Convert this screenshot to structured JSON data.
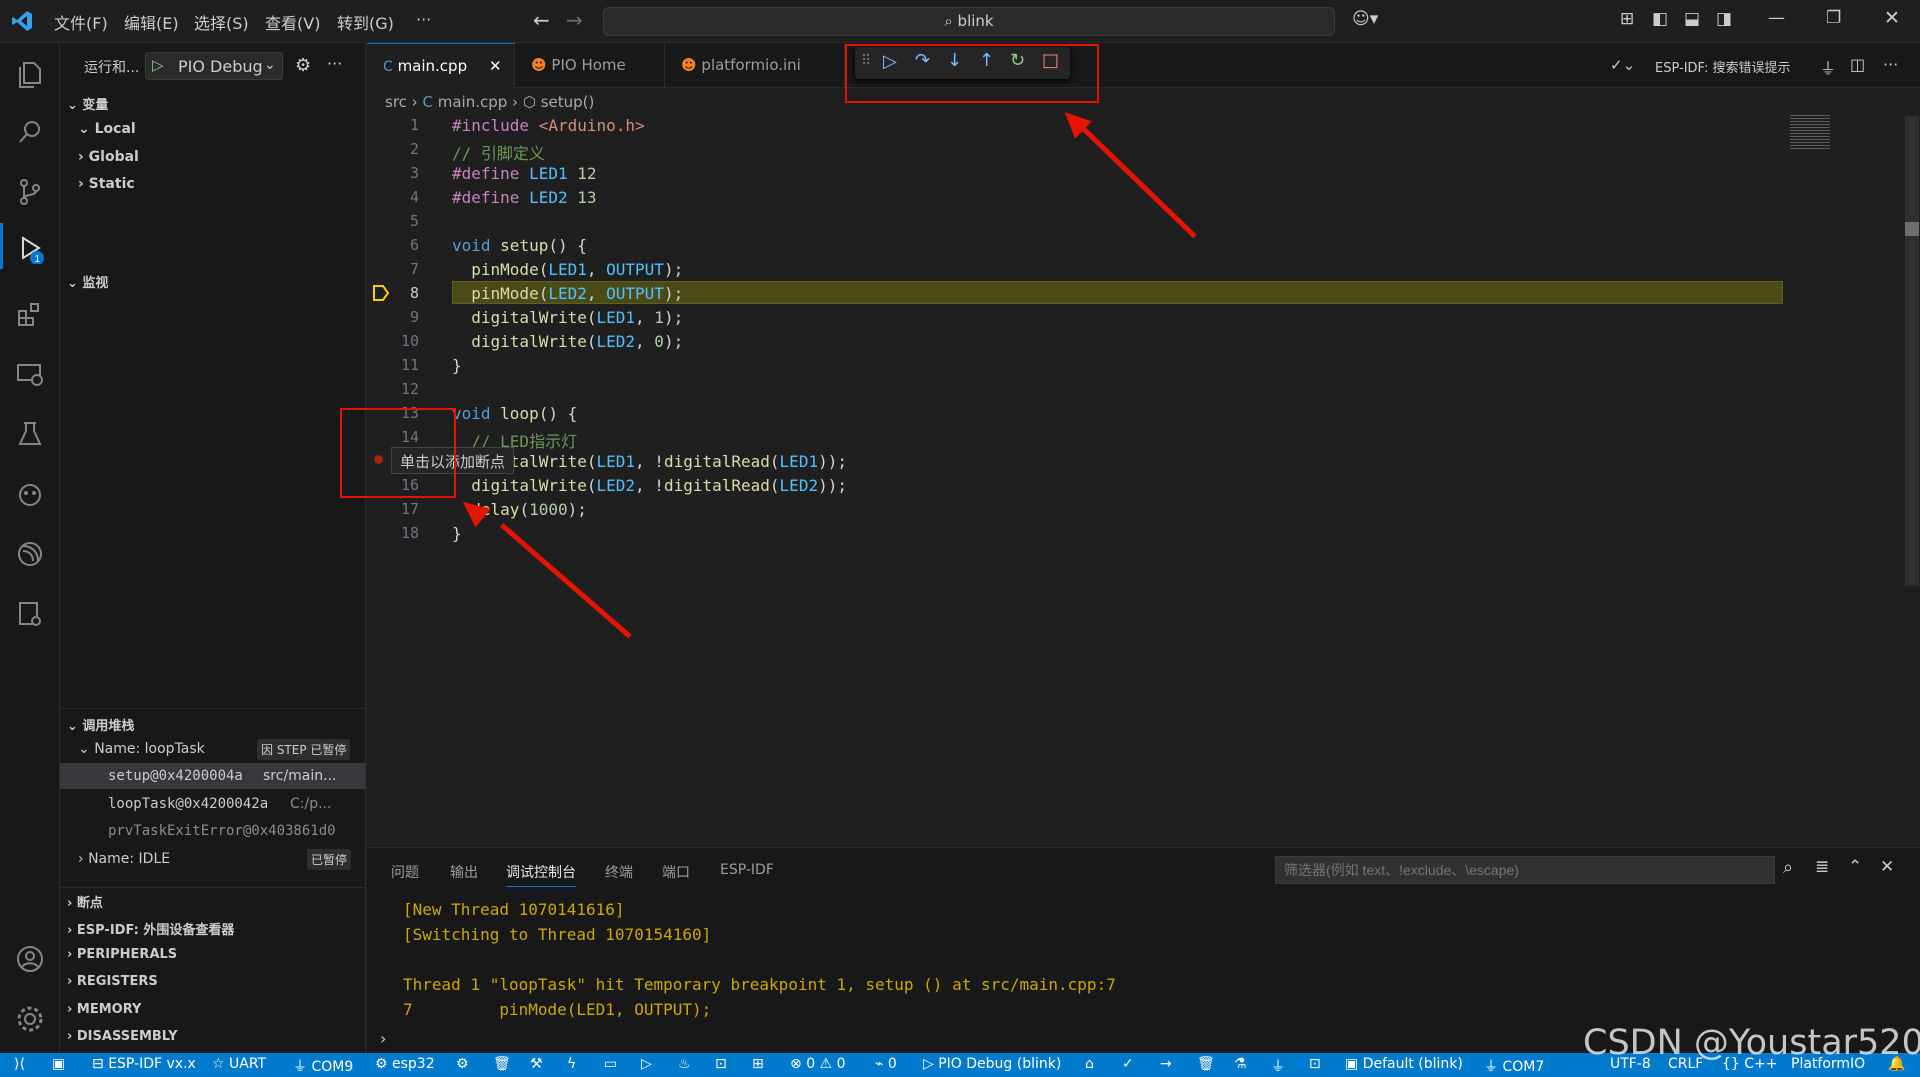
{
  "menus": [
    "文件(F)",
    "编辑(E)",
    "选择(S)",
    "查看(V)",
    "转到(G)",
    "···"
  ],
  "search": "blink",
  "sidebar": {
    "run_label": "运行和...",
    "config": "PIO Debug",
    "variables": "变量",
    "var_items": [
      "Local",
      "Global",
      "Static"
    ],
    "watch": "监视",
    "callstack": "调用堆栈",
    "thread1": "Name: loopTask",
    "thread1_badge": "因 STEP 已暂停",
    "frames": [
      {
        "name": "setup@0x4200004a",
        "file": "src/main..."
      },
      {
        "name": "loopTask@0x4200042a",
        "file": "C:/p..."
      },
      {
        "name": "prvTaskExitError@0x403861d0",
        "file": ""
      }
    ],
    "thread2": "Name: IDLE",
    "thread2_badge": "已暂停",
    "bottom": [
      "断点",
      "ESP-IDF: 外围设备查看器",
      "PERIPHERALS",
      "REGISTERS",
      "MEMORY",
      "DISASSEMBLY"
    ]
  },
  "tabs": [
    "main.cpp",
    "PIO Home",
    "platformio.ini"
  ],
  "breadcrumb": {
    "a": "src",
    "b": "main.cpp",
    "c": "setup()"
  },
  "right_toolbar": "ESP-IDF: 搜索错误提示",
  "hover_tip": "单击以添加断点",
  "panel": {
    "tabs": [
      "问题",
      "输出",
      "调试控制台",
      "终端",
      "端口",
      "ESP-IDF"
    ],
    "filter_placeholder": "筛选器(例如 text、!exclude、\\escape)",
    "lines": [
      "[New Thread 1070141616]",
      "[Switching to Thread 1070154160]",
      "",
      "Thread 1 \"loopTask\" hit Temporary breakpoint 1, setup () at src/main.cpp:7",
      "7         pinMode(LED1, OUTPUT);"
    ]
  },
  "status": {
    "items": [
      "ESP-IDF vx.x",
      "UART",
      "COM9",
      "esp32",
      "0",
      "0",
      "0",
      "PIO Debug (blink)",
      "Default (blink)",
      "COM7"
    ],
    "right": [
      "UTF-8",
      "CRLF",
      "{} C++",
      "PlatformIO"
    ]
  },
  "watermark": "CSDN @Youstar520"
}
